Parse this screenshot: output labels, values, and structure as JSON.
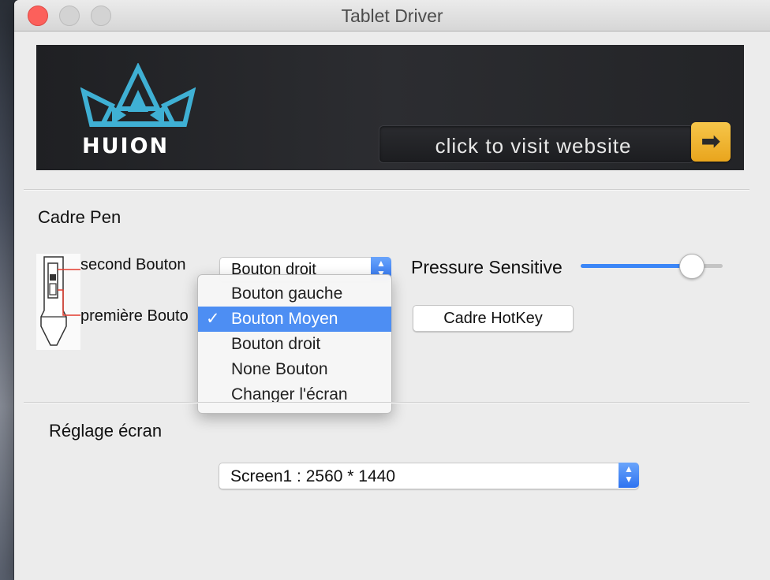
{
  "window": {
    "title": "Tablet Driver"
  },
  "banner": {
    "logo_text": "HUION",
    "visit_label": "click to visit website",
    "visit_arrow": "➡"
  },
  "pen_section": {
    "title": "Cadre Pen",
    "second_button_label": "second Bouton",
    "first_button_label": "première Bouto",
    "popup_value": "Bouton droit",
    "menu": {
      "items": [
        {
          "label": "Bouton gauche",
          "selected": false
        },
        {
          "label": "Bouton Moyen",
          "selected": true
        },
        {
          "label": "Bouton droit",
          "selected": false
        },
        {
          "label": "None Bouton",
          "selected": false
        },
        {
          "label": "Changer l'écran",
          "selected": false
        }
      ],
      "check_glyph": "✓"
    },
    "pressure_label": "Pressure Sensitive",
    "pressure_value": 0.78,
    "hotkey_button": "Cadre HotKey"
  },
  "screen_section": {
    "title": "Réglage écran",
    "screen_value": "Screen1 : 2560 * 1440"
  },
  "colors": {
    "accent": "#3b86f7",
    "menu_highlight": "#4d8ef3",
    "close_button": "#fc605b",
    "logo_blue": "#3fb0d4",
    "arrow_button": "#f0b630"
  },
  "icons": {
    "close": "close-icon",
    "minimize": "minimize-icon",
    "zoom": "zoom-icon",
    "arrow": "arrow-right-icon",
    "stepper": "stepper-icon",
    "pen": "pen-diagram-icon",
    "crown": "crown-logo-icon"
  }
}
